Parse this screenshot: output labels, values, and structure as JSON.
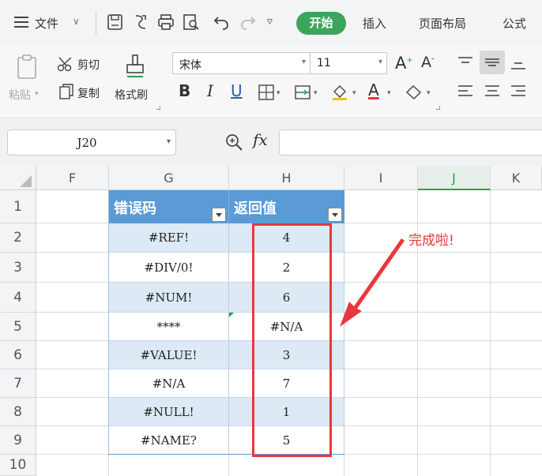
{
  "menu": {
    "file_label": "文件",
    "tabs": [
      "开始",
      "插入",
      "页面布局",
      "公式"
    ]
  },
  "ribbon": {
    "clipboard": {
      "paste_label": "粘贴",
      "cut_label": "剪切",
      "copy_label": "复制",
      "format_painter_label": "格式刷"
    },
    "font": {
      "name": "宋体",
      "size": "11"
    }
  },
  "formula_bar": {
    "name_box": "J20",
    "formula": ""
  },
  "sheet": {
    "columns": [
      "F",
      "G",
      "H",
      "I",
      "J",
      "K"
    ],
    "active_column": "J",
    "rows": [
      "1",
      "2",
      "3",
      "4",
      "5",
      "6",
      "7",
      "8",
      "9",
      "10"
    ],
    "table": {
      "headers": [
        "错误码",
        "返回值"
      ],
      "rows": [
        {
          "code": "#REF!",
          "value": "4"
        },
        {
          "code": "#DIV/0!",
          "value": "2"
        },
        {
          "code": "#NUM!",
          "value": "6"
        },
        {
          "code": "****",
          "value": "#N/A"
        },
        {
          "code": "#VALUE!",
          "value": "3"
        },
        {
          "code": "#N/A",
          "value": "7"
        },
        {
          "code": "#NULL!",
          "value": "1"
        },
        {
          "code": "#NAME?",
          "value": "5"
        }
      ]
    }
  },
  "annotation": {
    "text": "完成啦!",
    "color": "#e8383d"
  },
  "colors": {
    "accent_green": "#3ca55c",
    "table_header": "#5b9bd5",
    "table_band": "#dde9f5"
  }
}
